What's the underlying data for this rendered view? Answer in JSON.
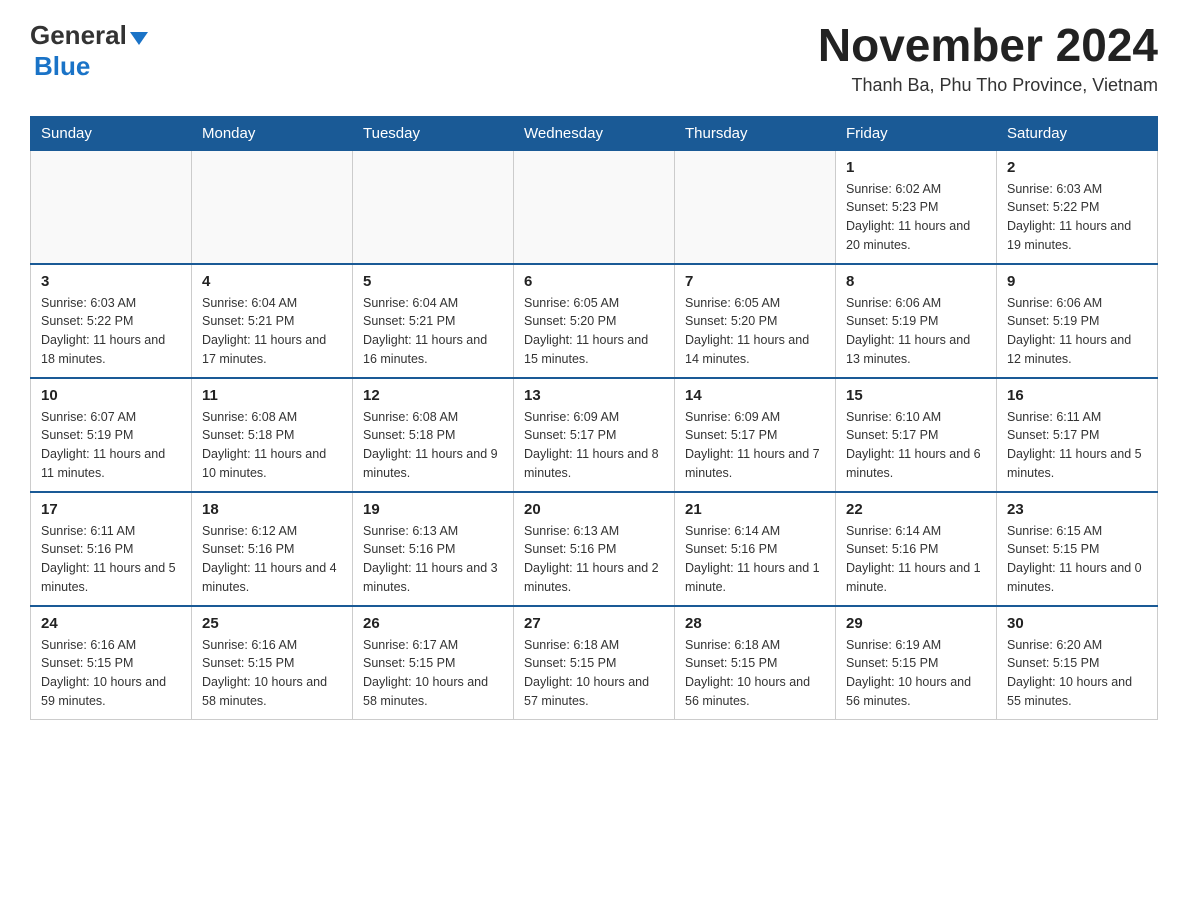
{
  "header": {
    "logo": {
      "word1": "General",
      "word2": "Blue"
    },
    "month_title": "November 2024",
    "location": "Thanh Ba, Phu Tho Province, Vietnam"
  },
  "days_of_week": [
    "Sunday",
    "Monday",
    "Tuesday",
    "Wednesday",
    "Thursday",
    "Friday",
    "Saturday"
  ],
  "weeks": [
    {
      "days": [
        {
          "num": "",
          "info": ""
        },
        {
          "num": "",
          "info": ""
        },
        {
          "num": "",
          "info": ""
        },
        {
          "num": "",
          "info": ""
        },
        {
          "num": "",
          "info": ""
        },
        {
          "num": "1",
          "info": "Sunrise: 6:02 AM\nSunset: 5:23 PM\nDaylight: 11 hours and 20 minutes."
        },
        {
          "num": "2",
          "info": "Sunrise: 6:03 AM\nSunset: 5:22 PM\nDaylight: 11 hours and 19 minutes."
        }
      ]
    },
    {
      "days": [
        {
          "num": "3",
          "info": "Sunrise: 6:03 AM\nSunset: 5:22 PM\nDaylight: 11 hours and 18 minutes."
        },
        {
          "num": "4",
          "info": "Sunrise: 6:04 AM\nSunset: 5:21 PM\nDaylight: 11 hours and 17 minutes."
        },
        {
          "num": "5",
          "info": "Sunrise: 6:04 AM\nSunset: 5:21 PM\nDaylight: 11 hours and 16 minutes."
        },
        {
          "num": "6",
          "info": "Sunrise: 6:05 AM\nSunset: 5:20 PM\nDaylight: 11 hours and 15 minutes."
        },
        {
          "num": "7",
          "info": "Sunrise: 6:05 AM\nSunset: 5:20 PM\nDaylight: 11 hours and 14 minutes."
        },
        {
          "num": "8",
          "info": "Sunrise: 6:06 AM\nSunset: 5:19 PM\nDaylight: 11 hours and 13 minutes."
        },
        {
          "num": "9",
          "info": "Sunrise: 6:06 AM\nSunset: 5:19 PM\nDaylight: 11 hours and 12 minutes."
        }
      ]
    },
    {
      "days": [
        {
          "num": "10",
          "info": "Sunrise: 6:07 AM\nSunset: 5:19 PM\nDaylight: 11 hours and 11 minutes."
        },
        {
          "num": "11",
          "info": "Sunrise: 6:08 AM\nSunset: 5:18 PM\nDaylight: 11 hours and 10 minutes."
        },
        {
          "num": "12",
          "info": "Sunrise: 6:08 AM\nSunset: 5:18 PM\nDaylight: 11 hours and 9 minutes."
        },
        {
          "num": "13",
          "info": "Sunrise: 6:09 AM\nSunset: 5:17 PM\nDaylight: 11 hours and 8 minutes."
        },
        {
          "num": "14",
          "info": "Sunrise: 6:09 AM\nSunset: 5:17 PM\nDaylight: 11 hours and 7 minutes."
        },
        {
          "num": "15",
          "info": "Sunrise: 6:10 AM\nSunset: 5:17 PM\nDaylight: 11 hours and 6 minutes."
        },
        {
          "num": "16",
          "info": "Sunrise: 6:11 AM\nSunset: 5:17 PM\nDaylight: 11 hours and 5 minutes."
        }
      ]
    },
    {
      "days": [
        {
          "num": "17",
          "info": "Sunrise: 6:11 AM\nSunset: 5:16 PM\nDaylight: 11 hours and 5 minutes."
        },
        {
          "num": "18",
          "info": "Sunrise: 6:12 AM\nSunset: 5:16 PM\nDaylight: 11 hours and 4 minutes."
        },
        {
          "num": "19",
          "info": "Sunrise: 6:13 AM\nSunset: 5:16 PM\nDaylight: 11 hours and 3 minutes."
        },
        {
          "num": "20",
          "info": "Sunrise: 6:13 AM\nSunset: 5:16 PM\nDaylight: 11 hours and 2 minutes."
        },
        {
          "num": "21",
          "info": "Sunrise: 6:14 AM\nSunset: 5:16 PM\nDaylight: 11 hours and 1 minute."
        },
        {
          "num": "22",
          "info": "Sunrise: 6:14 AM\nSunset: 5:16 PM\nDaylight: 11 hours and 1 minute."
        },
        {
          "num": "23",
          "info": "Sunrise: 6:15 AM\nSunset: 5:15 PM\nDaylight: 11 hours and 0 minutes."
        }
      ]
    },
    {
      "days": [
        {
          "num": "24",
          "info": "Sunrise: 6:16 AM\nSunset: 5:15 PM\nDaylight: 10 hours and 59 minutes."
        },
        {
          "num": "25",
          "info": "Sunrise: 6:16 AM\nSunset: 5:15 PM\nDaylight: 10 hours and 58 minutes."
        },
        {
          "num": "26",
          "info": "Sunrise: 6:17 AM\nSunset: 5:15 PM\nDaylight: 10 hours and 58 minutes."
        },
        {
          "num": "27",
          "info": "Sunrise: 6:18 AM\nSunset: 5:15 PM\nDaylight: 10 hours and 57 minutes."
        },
        {
          "num": "28",
          "info": "Sunrise: 6:18 AM\nSunset: 5:15 PM\nDaylight: 10 hours and 56 minutes."
        },
        {
          "num": "29",
          "info": "Sunrise: 6:19 AM\nSunset: 5:15 PM\nDaylight: 10 hours and 56 minutes."
        },
        {
          "num": "30",
          "info": "Sunrise: 6:20 AM\nSunset: 5:15 PM\nDaylight: 10 hours and 55 minutes."
        }
      ]
    }
  ]
}
